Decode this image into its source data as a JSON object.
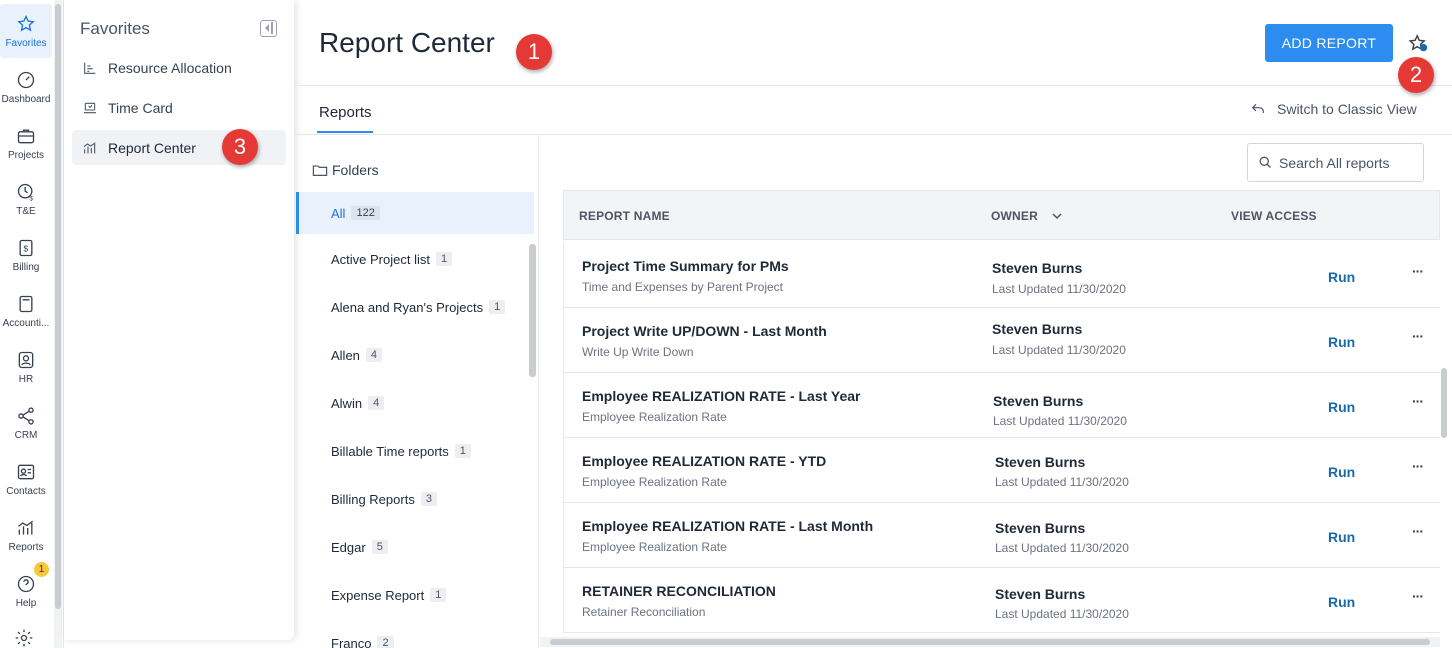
{
  "rail": {
    "items": [
      {
        "label": "Favorites",
        "icon": "star-icon"
      },
      {
        "label": "Dashboard",
        "icon": "gauge-icon"
      },
      {
        "label": "Projects",
        "icon": "briefcase-icon"
      },
      {
        "label": "T&E",
        "icon": "clock-dollar-icon"
      },
      {
        "label": "Billing",
        "icon": "bill-icon"
      },
      {
        "label": "Accounti...",
        "icon": "calculator-icon"
      },
      {
        "label": "HR",
        "icon": "person-badge-icon"
      },
      {
        "label": "CRM",
        "icon": "network-icon"
      },
      {
        "label": "Contacts",
        "icon": "contact-card-icon"
      },
      {
        "label": "Reports",
        "icon": "bar-chart-icon"
      },
      {
        "label": "Help",
        "icon": "help-icon"
      }
    ],
    "help_badge": "1"
  },
  "favorites": {
    "title": "Favorites",
    "items": [
      {
        "label": "Resource Allocation"
      },
      {
        "label": "Time Card"
      },
      {
        "label": "Report Center"
      }
    ]
  },
  "callouts": [
    "1",
    "2",
    "3"
  ],
  "header": {
    "title": "Report Center",
    "add_button": "ADD REPORT"
  },
  "tabs": {
    "reports": "Reports",
    "classic": "Switch to Classic View"
  },
  "folders": {
    "heading": "Folders",
    "items": [
      {
        "name": "All",
        "count": "122"
      },
      {
        "name": "Active Project list",
        "count": "1"
      },
      {
        "name": "Alena and Ryan's Projects",
        "count": "1"
      },
      {
        "name": "Allen",
        "count": "4"
      },
      {
        "name": "Alwin",
        "count": "4"
      },
      {
        "name": "Billable Time reports",
        "count": "1"
      },
      {
        "name": "Billing Reports",
        "count": "3"
      },
      {
        "name": "Edgar",
        "count": "5"
      },
      {
        "name": "Expense Report",
        "count": "1"
      },
      {
        "name": "Franco",
        "count": "2"
      }
    ]
  },
  "search": {
    "placeholder": "Search All reports"
  },
  "table": {
    "headers": {
      "name": "REPORT NAME",
      "owner": "OWNER",
      "access": "VIEW ACCESS"
    },
    "rows": [
      {
        "name": "Project Time Summary for PMs",
        "sub": "Time and Expenses by Parent Project",
        "owner": "Steven Burns",
        "updated": "Last Updated 11/30/2020",
        "action": "Run",
        "more": "···"
      },
      {
        "name": "Project Write UP/DOWN - Last Month",
        "sub": "Write Up Write Down",
        "owner": "Steven Burns",
        "updated": "Last Updated 11/30/2020",
        "action": "Run",
        "more": "···"
      },
      {
        "name": "Employee REALIZATION RATE - Last Year",
        "sub": "Employee Realization Rate",
        "owner": "Steven Burns",
        "updated": "Last Updated 11/30/2020",
        "action": "Run",
        "more": "···"
      },
      {
        "name": "Employee REALIZATION RATE - YTD",
        "sub": "Employee Realization Rate",
        "owner": "Steven Burns",
        "updated": "Last Updated 11/30/2020",
        "action": "Run",
        "more": "···"
      },
      {
        "name": "Employee REALIZATION RATE - Last Month",
        "sub": "Employee Realization Rate",
        "owner": "Steven Burns",
        "updated": "Last Updated 11/30/2020",
        "action": "Run",
        "more": "···"
      },
      {
        "name": "RETAINER RECONCILIATION",
        "sub": "Retainer Reconciliation",
        "owner": "Steven Burns",
        "updated": "Last Updated 11/30/2020",
        "action": "Run",
        "more": "···"
      }
    ]
  },
  "colors": {
    "accent": "#2d8cf0",
    "callout": "#e53935",
    "link": "#1a6aa8"
  }
}
